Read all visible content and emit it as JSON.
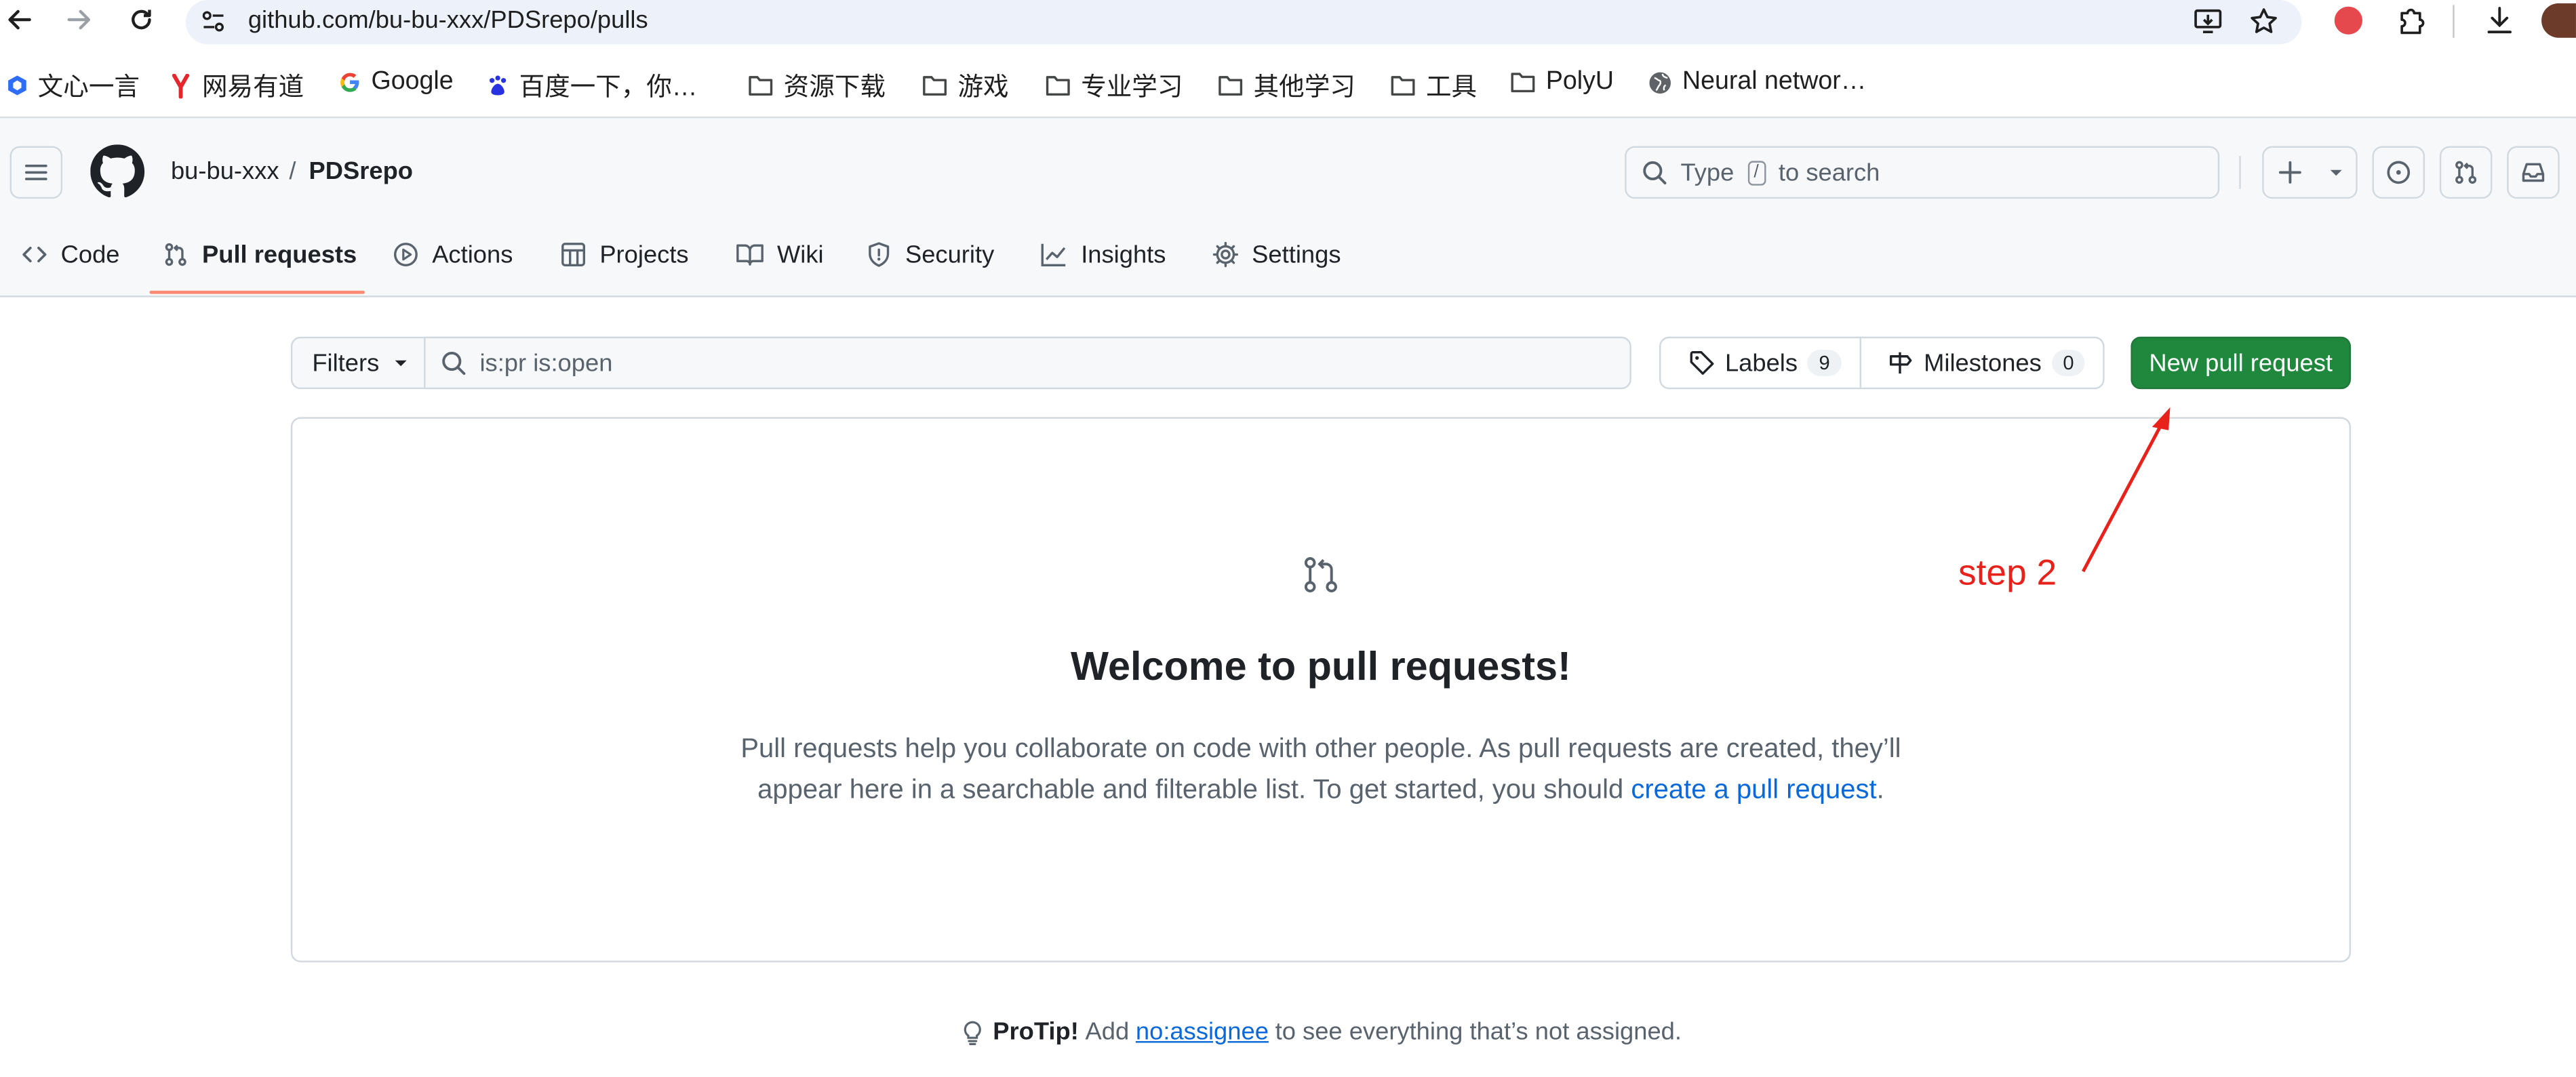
{
  "browser": {
    "url": "github.com/bu-bu-xxx/PDSrepo/pulls",
    "bookmarks": [
      {
        "label": "文心一言",
        "icon": "wenxin-icon"
      },
      {
        "label": "网易有道",
        "icon": "youdao-icon"
      },
      {
        "label": "Google",
        "icon": "google-icon"
      },
      {
        "label": "百度一下，你…",
        "icon": "baidu-icon"
      },
      {
        "label": "资源下载",
        "icon": "folder-icon"
      },
      {
        "label": "游戏",
        "icon": "folder-icon"
      },
      {
        "label": "专业学习",
        "icon": "folder-icon"
      },
      {
        "label": "其他学习",
        "icon": "folder-icon"
      },
      {
        "label": "工具",
        "icon": "folder-icon"
      },
      {
        "label": "PolyU",
        "icon": "folder-icon"
      },
      {
        "label": "Neural networ…",
        "icon": "globe-icon"
      }
    ]
  },
  "repo": {
    "owner": "bu-bu-xxx",
    "separator": "/",
    "name": "PDSrepo"
  },
  "search": {
    "prefix": "Type",
    "key": "/",
    "suffix": "to search"
  },
  "nav": {
    "tabs": [
      {
        "label": "Code",
        "icon": "code-icon"
      },
      {
        "label": "Pull requests",
        "icon": "git-pull-request-icon",
        "active": true
      },
      {
        "label": "Actions",
        "icon": "play-icon"
      },
      {
        "label": "Projects",
        "icon": "table-icon"
      },
      {
        "label": "Wiki",
        "icon": "book-icon"
      },
      {
        "label": "Security",
        "icon": "shield-icon"
      },
      {
        "label": "Insights",
        "icon": "graph-icon"
      },
      {
        "label": "Settings",
        "icon": "gear-icon"
      }
    ]
  },
  "filters": {
    "button_label": "Filters",
    "query": "is:pr is:open",
    "labels_label": "Labels",
    "labels_count": "9",
    "milestones_label": "Milestones",
    "milestones_count": "0",
    "new_pr_label": "New pull request"
  },
  "blankslate": {
    "title": "Welcome to pull requests!",
    "desc_before": "Pull requests help you collaborate on code with other people. As pull requests are created, they’ll appear here in a searchable and filterable list. To get started, you should ",
    "desc_link": "create a pull request",
    "desc_after": "."
  },
  "protip": {
    "label": "ProTip!",
    "before": "Add",
    "link": "no:assignee",
    "after": "to see everything that’s not assigned."
  },
  "annotation": {
    "text": "step 2",
    "color": "#e8211a"
  },
  "colors": {
    "primary_button": "#1f883d",
    "link": "#0969da",
    "active_tab_underline": "#fd8c73"
  }
}
